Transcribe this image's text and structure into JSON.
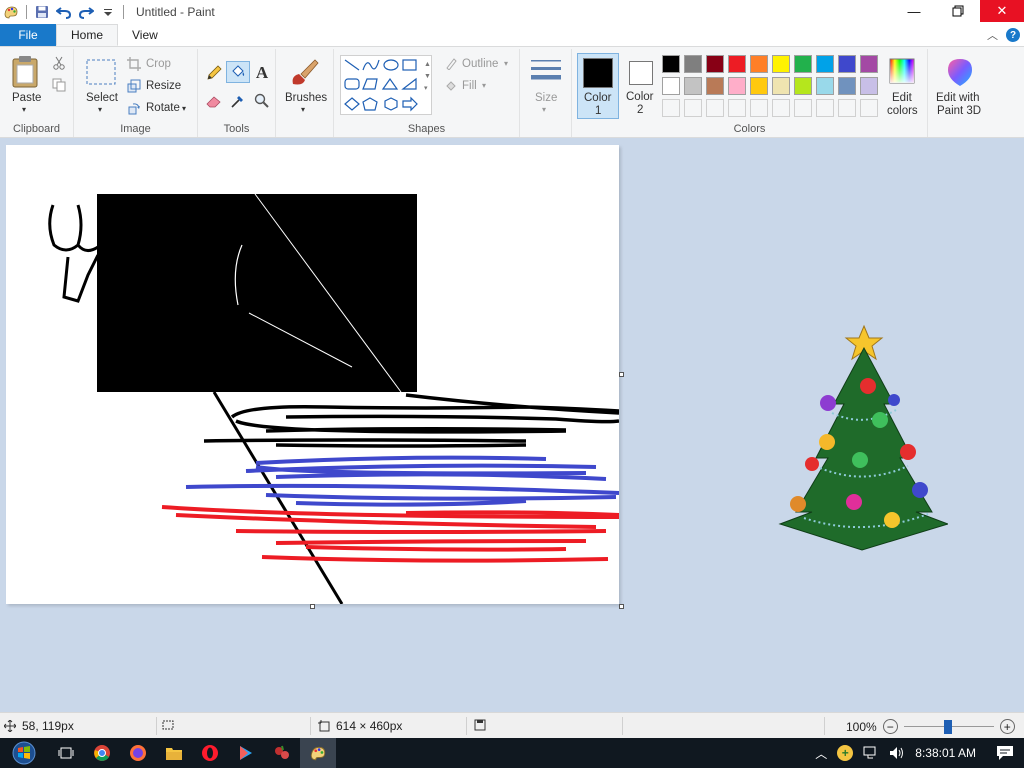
{
  "window": {
    "title": "Untitled - Paint"
  },
  "tabs": {
    "file": "File",
    "home": "Home",
    "view": "View"
  },
  "clipboard": {
    "paste": "Paste",
    "group_label": "Clipboard"
  },
  "image": {
    "select": "Select",
    "crop": "Crop",
    "resize": "Resize",
    "rotate": "Rotate",
    "group_label": "Image"
  },
  "tools": {
    "group_label": "Tools",
    "text_glyph": "A"
  },
  "brushes": {
    "label": "Brushes"
  },
  "shapes": {
    "outline": "Outline",
    "fill": "Fill",
    "group_label": "Shapes"
  },
  "size": {
    "label": "Size"
  },
  "colors": {
    "color1_label": "Color",
    "color1_num": "1",
    "color2_label": "Color",
    "color2_num": "2",
    "edit_colors_1": "Edit",
    "edit_colors_2": "colors",
    "group_label": "Colors",
    "color1_value": "#000000",
    "color2_value": "#ffffff",
    "palette_row1": [
      "#000000",
      "#7f7f7f",
      "#880015",
      "#ed1c24",
      "#ff7f27",
      "#fff200",
      "#22b14c",
      "#00a2e8",
      "#3f48cc",
      "#a349a4"
    ],
    "palette_row2": [
      "#ffffff",
      "#c3c3c3",
      "#b97a57",
      "#ffaec9",
      "#ffc90e",
      "#efe4b0",
      "#b5e61d",
      "#99d9ea",
      "#7092be",
      "#c8bfe7"
    ]
  },
  "paint3d": {
    "line1": "Edit with",
    "line2": "Paint 3D"
  },
  "status": {
    "cursor_pos": "58, 119px",
    "image_size": "614 × 460px",
    "zoom": "100%",
    "zoom_level": 1.0
  },
  "taskbar": {
    "time": "8:38:01 AM"
  }
}
